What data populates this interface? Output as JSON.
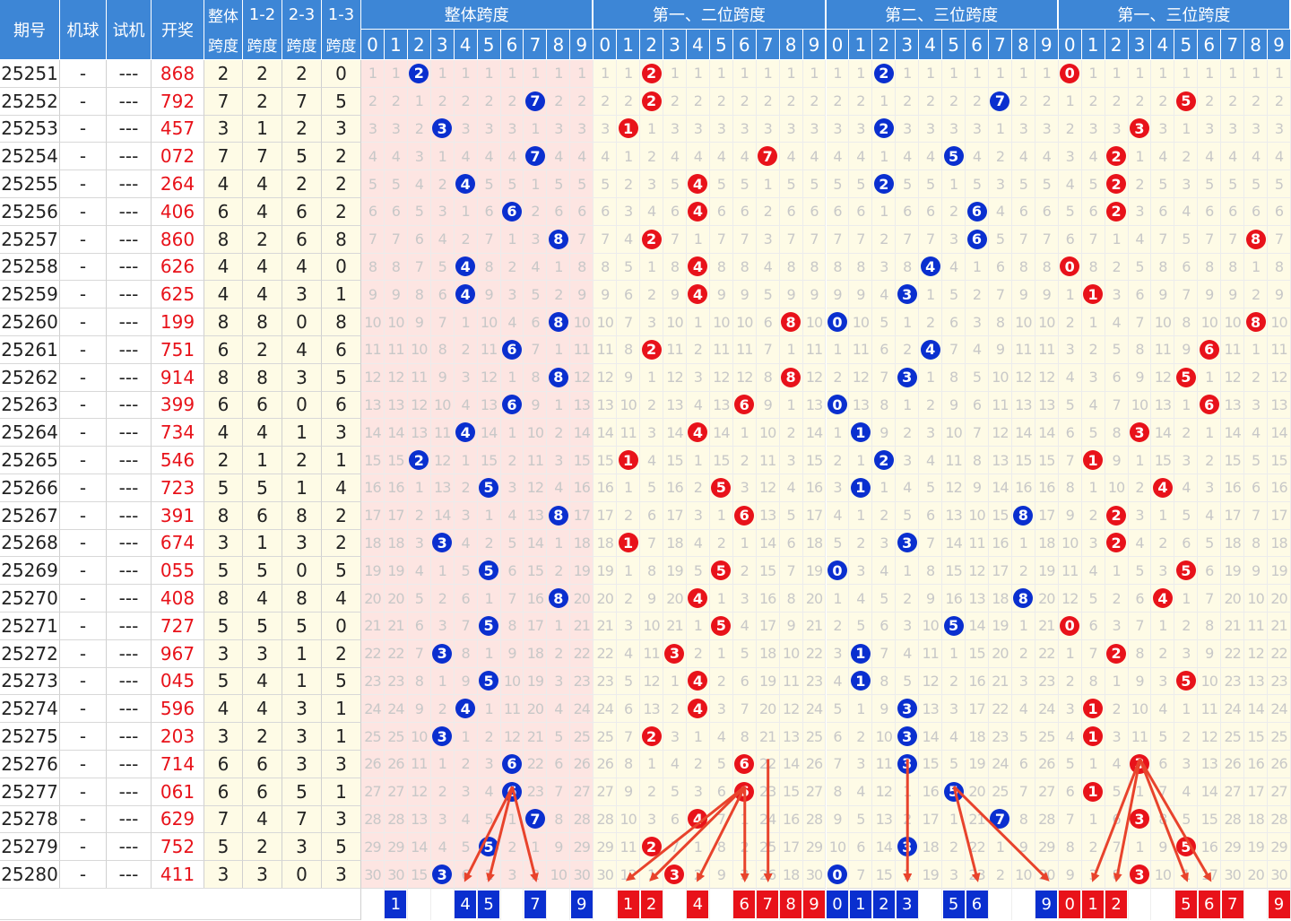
{
  "headers": {
    "issue": "期号",
    "machine": "机球",
    "trial": "试机",
    "draw": "开奖",
    "overall_span": [
      "整体",
      "跨度"
    ],
    "span12": [
      "1-2",
      "跨度"
    ],
    "span23": [
      "2-3",
      "跨度"
    ],
    "span13": [
      "1-3",
      "跨度"
    ],
    "groups": [
      "整体跨度",
      "第一、二位跨度",
      "第二、三位跨度",
      "第一、三位跨度"
    ],
    "digits": [
      "0",
      "1",
      "2",
      "3",
      "4",
      "5",
      "6",
      "7",
      "8",
      "9"
    ]
  },
  "colors": {
    "header_bg": "#3d86d6",
    "blue_ball": "#0a2fcf",
    "red_ball": "#e8121a",
    "pink_bg": "#fde5e2",
    "yellow_bg": "#fefbe6",
    "arrow": "#e8432c"
  },
  "rows": [
    {
      "issue": "25251",
      "machine": "-",
      "trial": "---",
      "draw": "868",
      "spans": [
        2,
        2,
        2,
        0
      ]
    },
    {
      "issue": "25252",
      "machine": "-",
      "trial": "---",
      "draw": "792",
      "spans": [
        7,
        2,
        7,
        5
      ]
    },
    {
      "issue": "25253",
      "machine": "-",
      "trial": "---",
      "draw": "457",
      "spans": [
        3,
        1,
        2,
        3
      ]
    },
    {
      "issue": "25254",
      "machine": "-",
      "trial": "---",
      "draw": "072",
      "spans": [
        7,
        7,
        5,
        2
      ]
    },
    {
      "issue": "25255",
      "machine": "-",
      "trial": "---",
      "draw": "264",
      "spans": [
        4,
        4,
        2,
        2
      ]
    },
    {
      "issue": "25256",
      "machine": "-",
      "trial": "---",
      "draw": "406",
      "spans": [
        6,
        4,
        6,
        2
      ]
    },
    {
      "issue": "25257",
      "machine": "-",
      "trial": "---",
      "draw": "860",
      "spans": [
        8,
        2,
        6,
        8
      ]
    },
    {
      "issue": "25258",
      "machine": "-",
      "trial": "---",
      "draw": "626",
      "spans": [
        4,
        4,
        4,
        0
      ]
    },
    {
      "issue": "25259",
      "machine": "-",
      "trial": "---",
      "draw": "625",
      "spans": [
        4,
        4,
        3,
        1
      ]
    },
    {
      "issue": "25260",
      "machine": "-",
      "trial": "---",
      "draw": "199",
      "spans": [
        8,
        8,
        0,
        8
      ]
    },
    {
      "issue": "25261",
      "machine": "-",
      "trial": "---",
      "draw": "751",
      "spans": [
        6,
        2,
        4,
        6
      ]
    },
    {
      "issue": "25262",
      "machine": "-",
      "trial": "---",
      "draw": "914",
      "spans": [
        8,
        8,
        3,
        5
      ]
    },
    {
      "issue": "25263",
      "machine": "-",
      "trial": "---",
      "draw": "399",
      "spans": [
        6,
        6,
        0,
        6
      ]
    },
    {
      "issue": "25264",
      "machine": "-",
      "trial": "---",
      "draw": "734",
      "spans": [
        4,
        4,
        1,
        3
      ]
    },
    {
      "issue": "25265",
      "machine": "-",
      "trial": "---",
      "draw": "546",
      "spans": [
        2,
        1,
        2,
        1
      ]
    },
    {
      "issue": "25266",
      "machine": "-",
      "trial": "---",
      "draw": "723",
      "spans": [
        5,
        5,
        1,
        4
      ]
    },
    {
      "issue": "25267",
      "machine": "-",
      "trial": "---",
      "draw": "391",
      "spans": [
        8,
        6,
        8,
        2
      ]
    },
    {
      "issue": "25268",
      "machine": "-",
      "trial": "---",
      "draw": "674",
      "spans": [
        3,
        1,
        3,
        2
      ]
    },
    {
      "issue": "25269",
      "machine": "-",
      "trial": "---",
      "draw": "055",
      "spans": [
        5,
        5,
        0,
        5
      ]
    },
    {
      "issue": "25270",
      "machine": "-",
      "trial": "---",
      "draw": "408",
      "spans": [
        8,
        4,
        8,
        4
      ]
    },
    {
      "issue": "25271",
      "machine": "-",
      "trial": "---",
      "draw": "727",
      "spans": [
        5,
        5,
        5,
        0
      ]
    },
    {
      "issue": "25272",
      "machine": "-",
      "trial": "---",
      "draw": "967",
      "spans": [
        3,
        3,
        1,
        2
      ]
    },
    {
      "issue": "25273",
      "machine": "-",
      "trial": "---",
      "draw": "045",
      "spans": [
        5,
        4,
        1,
        5
      ]
    },
    {
      "issue": "25274",
      "machine": "-",
      "trial": "---",
      "draw": "596",
      "spans": [
        4,
        4,
        3,
        1
      ]
    },
    {
      "issue": "25275",
      "machine": "-",
      "trial": "---",
      "draw": "203",
      "spans": [
        3,
        2,
        3,
        1
      ]
    },
    {
      "issue": "25276",
      "machine": "-",
      "trial": "---",
      "draw": "714",
      "spans": [
        6,
        6,
        3,
        3
      ]
    },
    {
      "issue": "25277",
      "machine": "-",
      "trial": "---",
      "draw": "061",
      "spans": [
        6,
        6,
        5,
        1
      ]
    },
    {
      "issue": "25278",
      "machine": "-",
      "trial": "---",
      "draw": "629",
      "spans": [
        7,
        4,
        7,
        3
      ]
    },
    {
      "issue": "25279",
      "machine": "-",
      "trial": "---",
      "draw": "752",
      "spans": [
        5,
        2,
        3,
        5
      ]
    },
    {
      "issue": "25280",
      "machine": "-",
      "trial": "---",
      "draw": "411",
      "spans": [
        3,
        3,
        0,
        3
      ]
    }
  ],
  "predictions": [
    [
      1,
      4,
      5,
      7,
      9
    ],
    [
      1,
      2,
      4,
      6,
      7,
      8,
      9
    ],
    [
      0,
      1,
      2,
      3,
      5,
      6,
      9
    ],
    [
      0,
      1,
      2,
      5,
      6,
      7,
      9
    ]
  ]
}
